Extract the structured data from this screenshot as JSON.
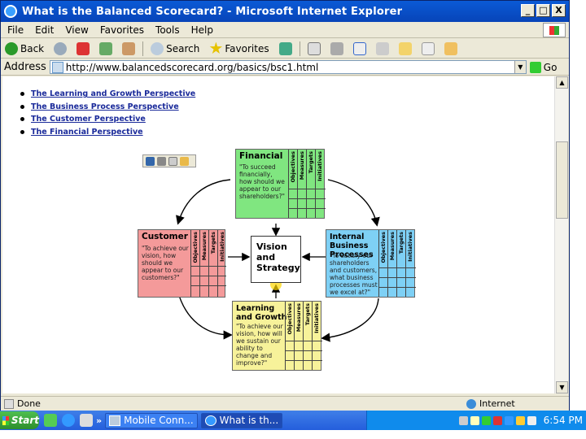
{
  "window": {
    "title": "What is the Balanced Scorecard? - Microsoft Internet Explorer",
    "buttons": {
      "minimize": "_",
      "maximize": "□",
      "close": "X"
    }
  },
  "menubar": [
    "File",
    "Edit",
    "View",
    "Favorites",
    "Tools",
    "Help"
  ],
  "toolbar": {
    "back": "Back",
    "search": "Search",
    "favorites": "Favorites"
  },
  "address": {
    "label": "Address",
    "url": "http://www.balancedscorecard.org/basics/bsc1.html",
    "go": "Go"
  },
  "page": {
    "links": [
      "The Learning and Growth Perspective",
      "The Business Process Perspective",
      "The Customer Perspective",
      "The Financial Perspective"
    ],
    "diagram": {
      "financial": {
        "title": "Financial",
        "desc": "\"To succeed financially, how should we appear to our shareholders?\"",
        "color": "#80e680"
      },
      "customer": {
        "title": "Customer",
        "desc": "\"To achieve our vision, how should we appear to our customers?\"",
        "color": "#f49a9a"
      },
      "internal": {
        "title": "Internal Business Processes",
        "desc": "\"To satisfy our shareholders and customers, what business processes must we excel at?\"",
        "color": "#7ed0f5"
      },
      "learning": {
        "title": "Learning and Growth",
        "desc": "\"To achieve our vision, how will we sustain our ability to change and improve?\"",
        "color": "#f7f29a"
      },
      "vision": "Vision and Strategy",
      "columns": [
        "Objectives",
        "Measures",
        "Targets",
        "Initiatives"
      ]
    }
  },
  "status": {
    "text": "Done",
    "zone": "Internet"
  },
  "taskbar": {
    "start": "Start",
    "more": "»",
    "tasks": [
      "Mobile Conn...",
      "What is th..."
    ],
    "clock": "6:54 PM"
  }
}
